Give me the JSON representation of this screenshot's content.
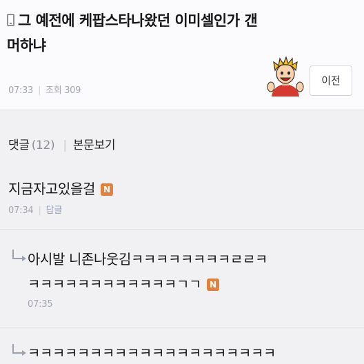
{
  "post": {
    "title_line1": "그 예전에 케팝스타나왔던 이미셀인가 갠",
    "title_line2": "머하냐",
    "time": "07:33",
    "views": "조회 309",
    "prev_button_label": "이전",
    "icons": [
      "mobile-icon",
      "avatar"
    ]
  },
  "comments_header": {
    "label": "댓글",
    "count": "(12)",
    "view_post_label": "본문보기"
  },
  "comments": [
    {
      "text": "지금자고있을걸",
      "badge": "N",
      "time": "07:34",
      "reply_label": "답글"
    }
  ],
  "replies": [
    {
      "line1": "아시발 니존나웃김ㅋㅋㅋㅋㅋㅋㅋㅋㄹㄹㅋ",
      "line2": "ㅋㅋㅋㅋㅋㅋㅋㅋㅋㅋㅋㅋㄱㄱ",
      "badge": "N",
      "time": "07:35"
    },
    {
      "line1": "ㅋㅋㅋㅋㅋㅋㅋㅋㅋㅋㅋㅋㅋㅋㅋㅋㅋㅋㅋㅋ"
    }
  ],
  "colors": {
    "badge": "#e2803d",
    "meta_text": "#a2a6b0",
    "reply_link": "#8b9cc6",
    "background": "#f1f1f3"
  }
}
